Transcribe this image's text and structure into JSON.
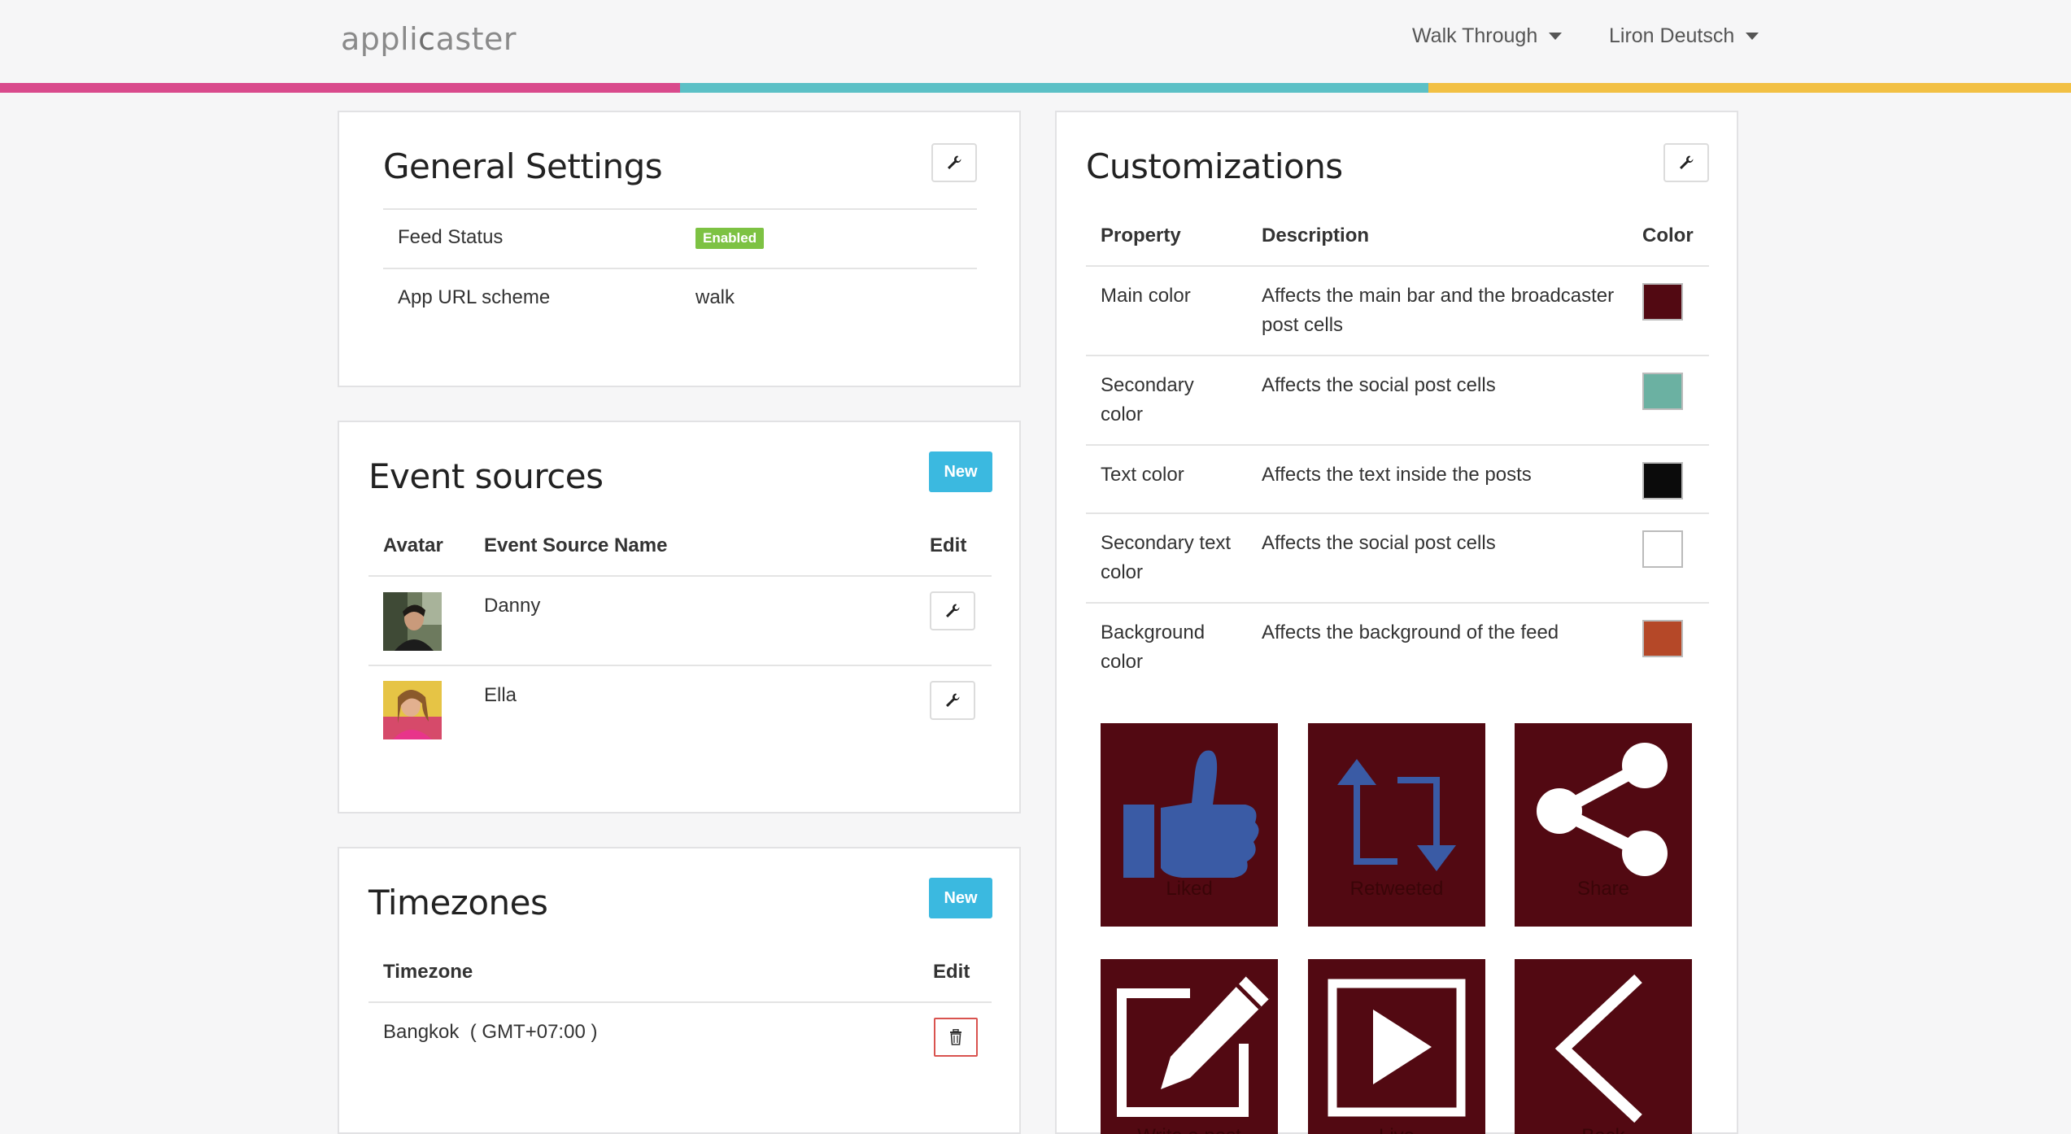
{
  "header": {
    "logo_part1": "appli",
    "logo_part2": "c",
    "logo_part3": "aster",
    "nav_walkthrough": "Walk Through",
    "nav_user": "Liron Deutsch"
  },
  "general_settings": {
    "title": "General Settings",
    "rows": [
      {
        "label": "Feed Status",
        "value": "Enabled"
      },
      {
        "label": "App URL scheme",
        "value": "walk"
      }
    ]
  },
  "event_sources": {
    "title": "Event sources",
    "new_label": "New",
    "headers": {
      "avatar": "Avatar",
      "name": "Event Source Name",
      "edit": "Edit"
    },
    "rows": [
      {
        "name": "Danny"
      },
      {
        "name": "Ella"
      }
    ]
  },
  "timezones": {
    "title": "Timezones",
    "new_label": "New",
    "headers": {
      "timezone": "Timezone",
      "edit": "Edit"
    },
    "rows": [
      {
        "timezone": "Bangkok  ( GMT+07:00 )"
      }
    ]
  },
  "customizations": {
    "title": "Customizations",
    "headers": {
      "property": "Property",
      "description": "Description",
      "color": "Color"
    },
    "rows": [
      {
        "property_l1": "Main color",
        "property_l2": "",
        "desc_l1": "Affects the main bar and the broadcaster",
        "desc_l2": "post cells",
        "color": "#520912"
      },
      {
        "property_l1": "Secondary",
        "property_l2": "color",
        "desc_l1": "Affects the social post cells",
        "desc_l2": "",
        "color": "#6bb1a2"
      },
      {
        "property_l1": "Text color",
        "property_l2": "",
        "desc_l1": "Affects the text inside the posts",
        "desc_l2": "",
        "color": "#0b0b0b"
      },
      {
        "property_l1": "Secondary text",
        "property_l2": "color",
        "desc_l1": "Affects the social post cells",
        "desc_l2": "",
        "color": "#ffffff"
      },
      {
        "property_l1": "Background",
        "property_l2": "color",
        "desc_l1": "Affects the background of the feed",
        "desc_l2": "",
        "color": "#b54828"
      }
    ],
    "tiles": [
      {
        "label": "Liked",
        "icon": "thumbs-up-icon"
      },
      {
        "label": "Retweeted",
        "icon": "retweet-icon"
      },
      {
        "label": "Share",
        "icon": "share-icon"
      },
      {
        "label": "Write a post",
        "icon": "edit-icon"
      },
      {
        "label": "Live",
        "icon": "play-icon"
      },
      {
        "label": "Back",
        "icon": "back-icon"
      }
    ],
    "tile_color": "#520912",
    "icon_blue": "#3a5ba5"
  }
}
